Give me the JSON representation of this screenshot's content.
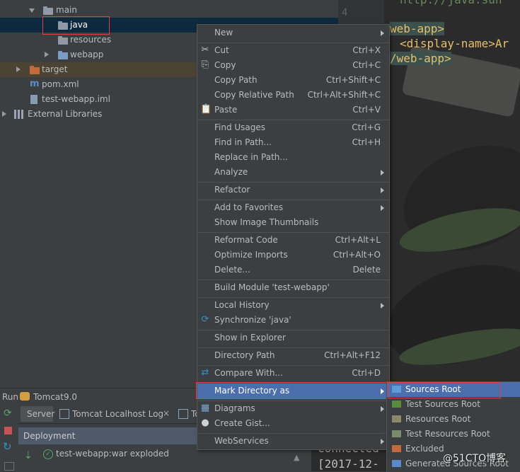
{
  "tree": {
    "items": [
      {
        "label": "main"
      },
      {
        "label": "java"
      },
      {
        "label": "resources"
      },
      {
        "label": "webapp"
      },
      {
        "label": "target"
      },
      {
        "label": "pom.xml"
      },
      {
        "label": "test-webapp.iml"
      },
      {
        "label": "External Libraries"
      }
    ]
  },
  "gutter": {
    "line_number": "4"
  },
  "editor": {
    "line0": "http://java.sun",
    "line1": "web-app>",
    "line2": "<display-name>Ar",
    "line3": "/web-app>"
  },
  "context_menu": {
    "new": "New",
    "cut": "Cut",
    "cut_sc": "Ctrl+X",
    "copy": "Copy",
    "copy_sc": "Ctrl+C",
    "copy_path": "Copy Path",
    "copy_path_sc": "Ctrl+Shift+C",
    "copy_rel": "Copy Relative Path",
    "copy_rel_sc": "Ctrl+Alt+Shift+C",
    "paste": "Paste",
    "paste_sc": "Ctrl+V",
    "find_usages": "Find Usages",
    "find_usages_sc": "Ctrl+G",
    "find_in_path": "Find in Path...",
    "find_in_path_sc": "Ctrl+H",
    "replace_in_path": "Replace in Path...",
    "analyze": "Analyze",
    "refactor": "Refactor",
    "add_fav": "Add to Favorites",
    "show_thumbs": "Show Image Thumbnails",
    "reformat": "Reformat Code",
    "reformat_sc": "Ctrl+Alt+L",
    "optimize": "Optimize Imports",
    "optimize_sc": "Ctrl+Alt+O",
    "delete": "Delete...",
    "delete_sc": "Delete",
    "build_module": "Build Module 'test-webapp'",
    "local_history": "Local History",
    "synchronize": "Synchronize 'java'",
    "show_explorer": "Show in Explorer",
    "dir_path": "Directory Path",
    "dir_path_sc": "Ctrl+Alt+F12",
    "compare": "Compare With...",
    "compare_sc": "Ctrl+D",
    "mark_dir": "Mark Directory as",
    "diagrams": "Diagrams",
    "create_gist": "Create Gist...",
    "webservices": "WebServices"
  },
  "submenu": {
    "sources_root": "Sources Root",
    "test_sources_root": "Test Sources Root",
    "resources_root": "Resources Root",
    "test_resources_root": "Test Resources Root",
    "excluded": "Excluded",
    "generated_sources": "Generated Sources Root"
  },
  "run_panel": {
    "run_label": "Run",
    "config": "Tomcat9.0",
    "tab_server": "Server",
    "tab_log": "Tomcat Localhost Log",
    "tab_third": "To",
    "deployment": "Deployment",
    "artifact": "test-webapp:war exploded"
  },
  "console": {
    "line1": "Connected",
    "line2": "[2017-12-"
  },
  "watermark": "@51CTO博客",
  "colors": {
    "selection": "#4b6eaf",
    "highlight_box": "#e04040",
    "folder_blue": "#7c9cc4",
    "folder_orange": "#c26a3a",
    "xml_tag": "#e8bf6a"
  }
}
